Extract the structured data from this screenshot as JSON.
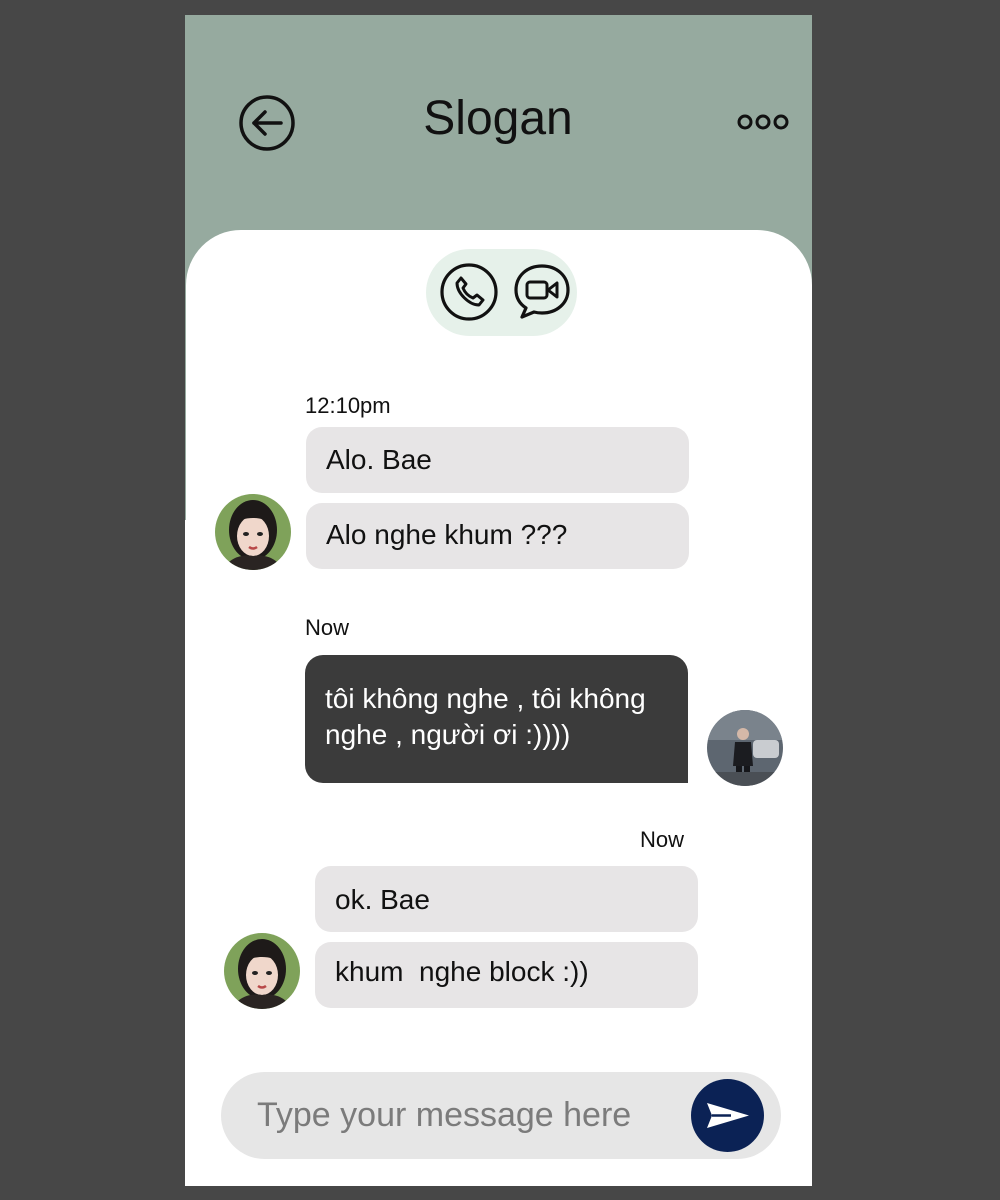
{
  "header": {
    "title": "Slogan",
    "back_icon": "arrow-left-circle-icon",
    "more_icon": "three-dots-icon",
    "background_color": "#96aa9f"
  },
  "call_actions": {
    "voice_icon": "phone-icon",
    "video_icon": "video-chat-icon"
  },
  "messages": [
    {
      "timestamp": "12:10pm",
      "direction": "incoming",
      "bubbles": [
        "Alo. Bae",
        "Alo nghe khum ???"
      ]
    },
    {
      "timestamp": "Now",
      "direction": "outgoing",
      "lines": [
        "tôi không nghe , tôi không",
        "nghe , người ơi :))))"
      ]
    },
    {
      "timestamp": "Now",
      "direction": "incoming",
      "bubbles": [
        "ok. Bae",
        "khum  nghe block :))"
      ]
    }
  ],
  "composer": {
    "placeholder": "Type your message here",
    "send_icon": "paper-plane-icon",
    "send_color": "#0b2255"
  },
  "colors": {
    "incoming_bubble": "#e7e5e6",
    "outgoing_bubble": "#3b3b3b",
    "call_pill": "#e6f1ea"
  }
}
